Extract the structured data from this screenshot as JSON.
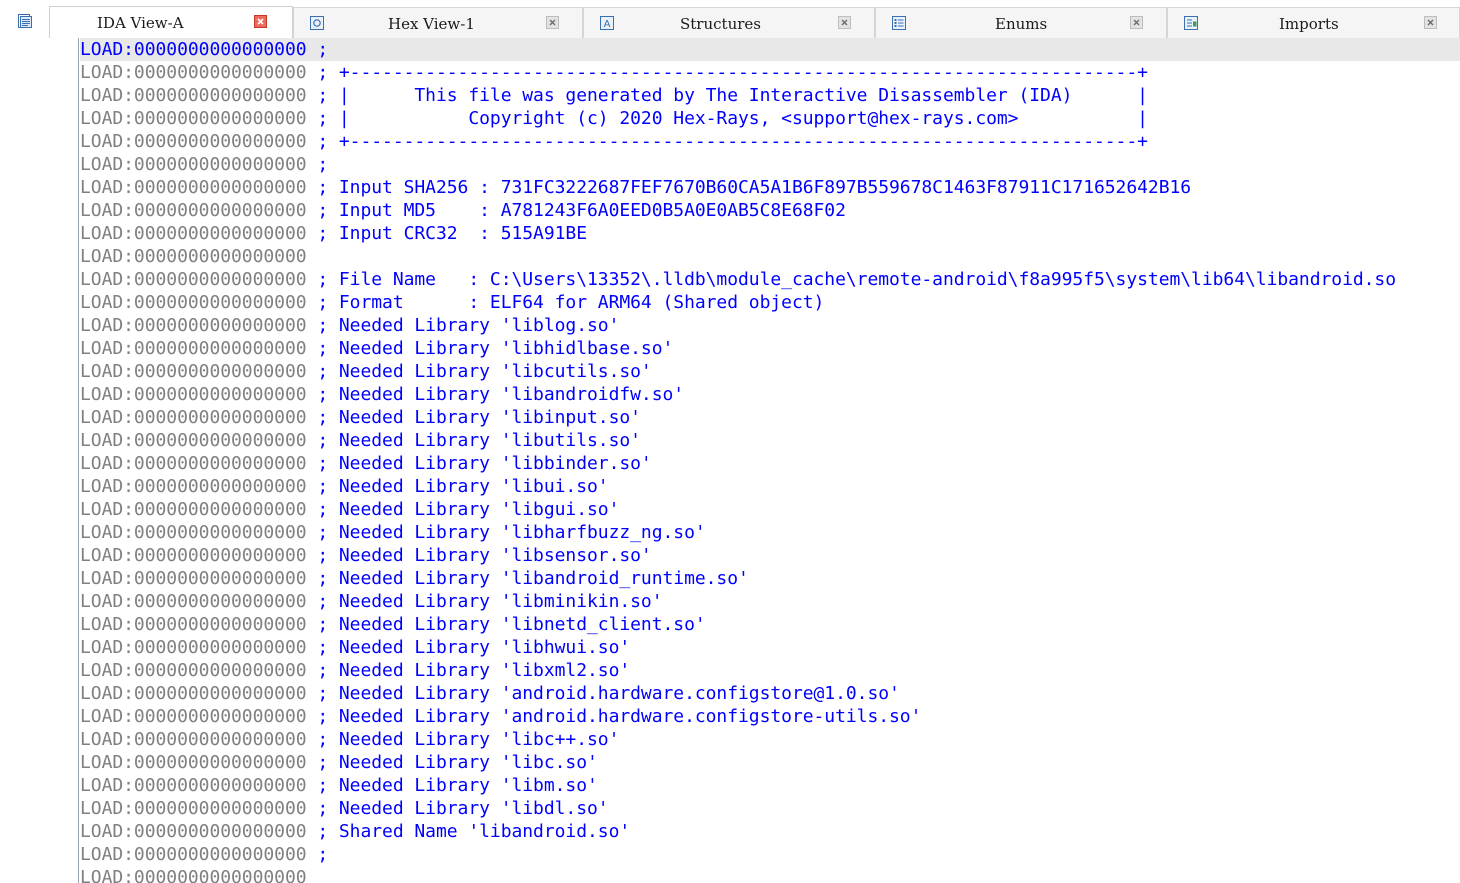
{
  "window": {
    "tabs": [
      {
        "label": "IDA View-A",
        "icon": "disasm-view-icon",
        "active": true
      },
      {
        "label": "Hex View-1",
        "icon": "hex-view-icon",
        "active": false
      },
      {
        "label": "Structures",
        "icon": "structures-icon",
        "active": false
      },
      {
        "label": "Enums",
        "icon": "enums-icon",
        "active": false
      },
      {
        "label": "Imports",
        "icon": "imports-icon",
        "active": false
      }
    ]
  },
  "colors": {
    "address": "#808080",
    "current_address": "#0000ff",
    "comment": "#0000ff",
    "current_line_bg": "#e8e8e8"
  },
  "disasm": {
    "lines": [
      {
        "addr": "LOAD:0000000000000000",
        "comment": " ;"
      },
      {
        "addr": "LOAD:0000000000000000",
        "comment": " ; +-------------------------------------------------------------------------+"
      },
      {
        "addr": "LOAD:0000000000000000",
        "comment": " ; |      This file was generated by The Interactive Disassembler (IDA)      |"
      },
      {
        "addr": "LOAD:0000000000000000",
        "comment": " ; |           Copyright (c) 2020 Hex-Rays, <support@hex-rays.com>           |"
      },
      {
        "addr": "LOAD:0000000000000000",
        "comment": " ; +-------------------------------------------------------------------------+"
      },
      {
        "addr": "LOAD:0000000000000000",
        "comment": " ;"
      },
      {
        "addr": "LOAD:0000000000000000",
        "comment": " ; Input SHA256 : 731FC3222687FEF7670B60CA5A1B6F897B559678C1463F87911C171652642B16"
      },
      {
        "addr": "LOAD:0000000000000000",
        "comment": " ; Input MD5    : A781243F6A0EED0B5A0E0AB5C8E68F02"
      },
      {
        "addr": "LOAD:0000000000000000",
        "comment": " ; Input CRC32  : 515A91BE"
      },
      {
        "addr": "LOAD:0000000000000000",
        "comment": ""
      },
      {
        "addr": "LOAD:0000000000000000",
        "comment": " ; File Name   : C:\\Users\\13352\\.lldb\\module_cache\\remote-android\\f8a995f5\\system\\lib64\\libandroid.so"
      },
      {
        "addr": "LOAD:0000000000000000",
        "comment": " ; Format      : ELF64 for ARM64 (Shared object)"
      },
      {
        "addr": "LOAD:0000000000000000",
        "comment": " ; Needed Library 'liblog.so'"
      },
      {
        "addr": "LOAD:0000000000000000",
        "comment": " ; Needed Library 'libhidlbase.so'"
      },
      {
        "addr": "LOAD:0000000000000000",
        "comment": " ; Needed Library 'libcutils.so'"
      },
      {
        "addr": "LOAD:0000000000000000",
        "comment": " ; Needed Library 'libandroidfw.so'"
      },
      {
        "addr": "LOAD:0000000000000000",
        "comment": " ; Needed Library 'libinput.so'"
      },
      {
        "addr": "LOAD:0000000000000000",
        "comment": " ; Needed Library 'libutils.so'"
      },
      {
        "addr": "LOAD:0000000000000000",
        "comment": " ; Needed Library 'libbinder.so'"
      },
      {
        "addr": "LOAD:0000000000000000",
        "comment": " ; Needed Library 'libui.so'"
      },
      {
        "addr": "LOAD:0000000000000000",
        "comment": " ; Needed Library 'libgui.so'"
      },
      {
        "addr": "LOAD:0000000000000000",
        "comment": " ; Needed Library 'libharfbuzz_ng.so'"
      },
      {
        "addr": "LOAD:0000000000000000",
        "comment": " ; Needed Library 'libsensor.so'"
      },
      {
        "addr": "LOAD:0000000000000000",
        "comment": " ; Needed Library 'libandroid_runtime.so'"
      },
      {
        "addr": "LOAD:0000000000000000",
        "comment": " ; Needed Library 'libminikin.so'"
      },
      {
        "addr": "LOAD:0000000000000000",
        "comment": " ; Needed Library 'libnetd_client.so'"
      },
      {
        "addr": "LOAD:0000000000000000",
        "comment": " ; Needed Library 'libhwui.so'"
      },
      {
        "addr": "LOAD:0000000000000000",
        "comment": " ; Needed Library 'libxml2.so'"
      },
      {
        "addr": "LOAD:0000000000000000",
        "comment": " ; Needed Library 'android.hardware.configstore@1.0.so'"
      },
      {
        "addr": "LOAD:0000000000000000",
        "comment": " ; Needed Library 'android.hardware.configstore-utils.so'"
      },
      {
        "addr": "LOAD:0000000000000000",
        "comment": " ; Needed Library 'libc++.so'"
      },
      {
        "addr": "LOAD:0000000000000000",
        "comment": " ; Needed Library 'libc.so'"
      },
      {
        "addr": "LOAD:0000000000000000",
        "comment": " ; Needed Library 'libm.so'"
      },
      {
        "addr": "LOAD:0000000000000000",
        "comment": " ; Needed Library 'libdl.so'"
      },
      {
        "addr": "LOAD:0000000000000000",
        "comment": " ; Shared Name 'libandroid.so'"
      },
      {
        "addr": "LOAD:0000000000000000",
        "comment": " ;"
      },
      {
        "addr": "LOAD:0000000000000000",
        "comment": ""
      }
    ]
  }
}
